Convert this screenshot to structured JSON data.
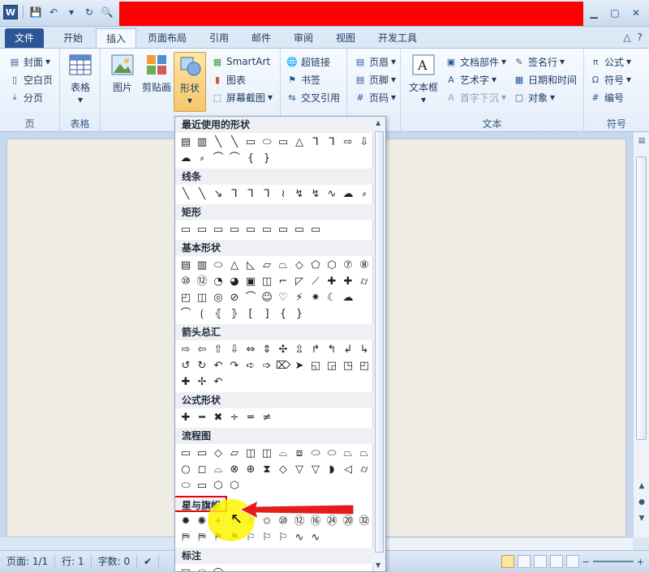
{
  "ribbon_tabs": [
    {
      "label": "文件",
      "kind": "file"
    },
    {
      "label": "开始",
      "kind": "normal"
    },
    {
      "label": "插入",
      "kind": "active"
    },
    {
      "label": "页面布局",
      "kind": "normal"
    },
    {
      "label": "引用",
      "kind": "normal"
    },
    {
      "label": "邮件",
      "kind": "normal"
    },
    {
      "label": "审阅",
      "kind": "normal"
    },
    {
      "label": "视图",
      "kind": "normal"
    },
    {
      "label": "开发工具",
      "kind": "normal"
    }
  ],
  "pages_group": {
    "label": "页",
    "cover": "封面",
    "blank": "空白页",
    "break": "分页"
  },
  "table_group": {
    "label": "表格",
    "table_button": "表格"
  },
  "illustrations": {
    "picture": "图片",
    "clipart": "剪贴画",
    "shapes": "形状",
    "smartart": "SmartArt",
    "chart": "图表",
    "screenshot": "屏幕截图"
  },
  "links_group": {
    "hyperlink": "超链接",
    "bookmark": "书签",
    "crossref": "交叉引用"
  },
  "header_footer": {
    "header": "页眉",
    "footer": "页脚",
    "page_number": "页码",
    "label_partial": "脚"
  },
  "text_group": {
    "label": "文本",
    "textbox": "文本框",
    "quickparts": "文档部件",
    "wordart": "艺术字",
    "dropcap": "首字下沉",
    "signature": "签名行",
    "datetime": "日期和时间",
    "object": "对象"
  },
  "symbols_group": {
    "label": "符号",
    "equation": "公式",
    "symbol": "符号",
    "number": "编号"
  },
  "shapes_gallery": {
    "sections": [
      {
        "title": "最近使用的形状",
        "rows": [
          [
            "▤",
            "▥",
            "╲",
            "╲",
            "▭",
            "⬭",
            "▭",
            "△",
            "⅂",
            "⅂",
            "⇨",
            "⇩"
          ],
          [
            "☁",
            "⸗",
            "⌒",
            "⌒",
            "{",
            "}"
          ]
        ]
      },
      {
        "title": "线条",
        "rows": [
          [
            "╲",
            "╲",
            "↘",
            "⅂",
            "⅂",
            "⅂",
            "≀",
            "↯",
            "↯",
            "∿",
            "☁",
            "⸗"
          ]
        ]
      },
      {
        "title": "矩形",
        "rows": [
          [
            "▭",
            "▭",
            "▭",
            "▭",
            "▭",
            "▭",
            "▭",
            "▭",
            "▭"
          ]
        ]
      },
      {
        "title": "基本形状",
        "rows": [
          [
            "▤",
            "▥",
            "⬭",
            "△",
            "◺",
            "▱",
            "⏢",
            "◇",
            "⬠",
            "⬡",
            "⑦",
            "⑧"
          ],
          [
            "⑩",
            "⑫",
            "◔",
            "◕",
            "▣",
            "◫",
            "⌐",
            "◸",
            "⟋",
            "✚",
            "✚",
            "⌭"
          ],
          [
            "◰",
            "◫",
            "◎",
            "⊘",
            "⌒",
            "☺",
            "♡",
            "⚡",
            "✷",
            "☾",
            "☁"
          ],
          [
            "⌒",
            "⟮",
            "⦃",
            "⦄",
            "[",
            "]",
            "{",
            "}"
          ]
        ]
      },
      {
        "title": "箭头总汇",
        "rows": [
          [
            "⇨",
            "⇦",
            "⇧",
            "⇩",
            "⇔",
            "⇕",
            "✣",
            "⇫",
            "↱",
            "↰",
            "↲",
            "↳"
          ],
          [
            "↺",
            "↻",
            "↶",
            "↷",
            "➪",
            "➩",
            "⌦",
            "➤",
            "◱",
            "◲",
            "◳",
            "◰"
          ],
          [
            "✚",
            "✢",
            "↶"
          ]
        ]
      },
      {
        "title": "公式形状",
        "rows": [
          [
            "✚",
            "━",
            "✖",
            "÷",
            "═",
            "≠"
          ]
        ]
      },
      {
        "title": "流程图",
        "rows": [
          [
            "▭",
            "▭",
            "◇",
            "▱",
            "◫",
            "◫",
            "⌓",
            "⧈",
            "⬭",
            "⬭",
            "⏢",
            "⏢"
          ],
          [
            "○",
            "◻",
            "⌓",
            "⊗",
            "⊕",
            "⧗",
            "◇",
            "▽",
            "▽",
            "◗",
            "◁",
            "⌭"
          ],
          [
            "⬭",
            "▭",
            "⬡",
            "⬡"
          ]
        ]
      },
      {
        "title": "星与旗帜",
        "rows": [
          [
            "✹",
            "✺",
            "✦",
            "☆",
            "✧",
            "✩",
            "⑩",
            "⑫",
            "⑯",
            "㉔",
            "⑳",
            "㉜"
          ],
          [
            "⛿",
            "⛿",
            "⚑",
            "⚑",
            "⚐",
            "⚐",
            "⚐",
            "∿",
            "∿"
          ]
        ]
      },
      {
        "title": "标注",
        "rows": [
          [
            "□",
            "◌",
            "◯",
            "☁",
            "⌐",
            "⌐",
            "⌐",
            "⌐",
            "⌐",
            "⌐",
            "⌐",
            "⌐"
          ]
        ]
      }
    ]
  },
  "status": {
    "page": "页面: 1/1",
    "line": "行: 1",
    "words": "字数: 0"
  },
  "colors": {
    "accent": "#2b5797",
    "redaction": "#ff0000",
    "highlight": "#fff500"
  }
}
